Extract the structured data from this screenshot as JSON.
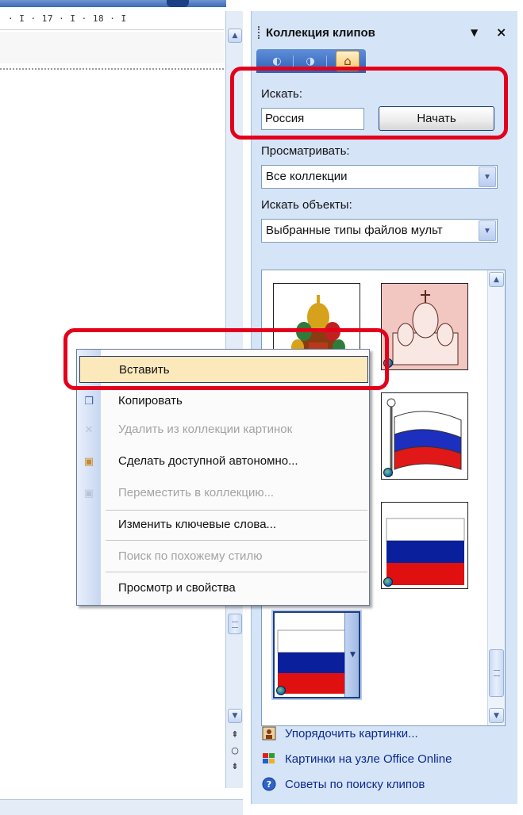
{
  "ruler": {
    "text": "· I · 17 · I · 18 · I"
  },
  "pane": {
    "title": "Коллекция клипов",
    "menu_glyph": "▼",
    "close_glyph": "×",
    "search_label": "Искать:",
    "search_value": "Россия",
    "start_button": "Начать",
    "browse_label": "Просматривать:",
    "browse_value": "Все коллекции",
    "objects_label": "Искать объекты:",
    "objects_value": "Выбранные типы файлов мульт",
    "links": [
      {
        "label": "Упорядочить картинки...",
        "icon": "organize-icon"
      },
      {
        "label": "Картинки на узле Office Online",
        "icon": "office-online-icon"
      },
      {
        "label": "Советы по поиску клипов",
        "icon": "help-icon"
      }
    ]
  },
  "context_menu": {
    "items": [
      {
        "label": "Вставить",
        "state": "highlighted",
        "icon": ""
      },
      {
        "label": "Копировать",
        "state": "enabled",
        "icon": "copy-icon"
      },
      {
        "label": "Удалить из коллекции картинок",
        "state": "disabled",
        "icon": "delete-icon"
      },
      {
        "label": "Сделать доступной автономно...",
        "state": "enabled",
        "icon": "offline-icon"
      },
      {
        "label": "Переместить в коллекцию...",
        "state": "disabled",
        "icon": "move-icon"
      },
      {
        "label": "Изменить ключевые слова...",
        "state": "enabled",
        "icon": ""
      },
      {
        "label": "Поиск по похожему стилю",
        "state": "disabled",
        "icon": ""
      },
      {
        "label": "Просмотр и свойства",
        "state": "enabled",
        "icon": ""
      }
    ]
  },
  "colors": {
    "highlight_outline": "#e3001b",
    "pane_bg": "#d6e4f8",
    "menu_hover": "#fbe9bc",
    "link": "#0b2a8c"
  }
}
